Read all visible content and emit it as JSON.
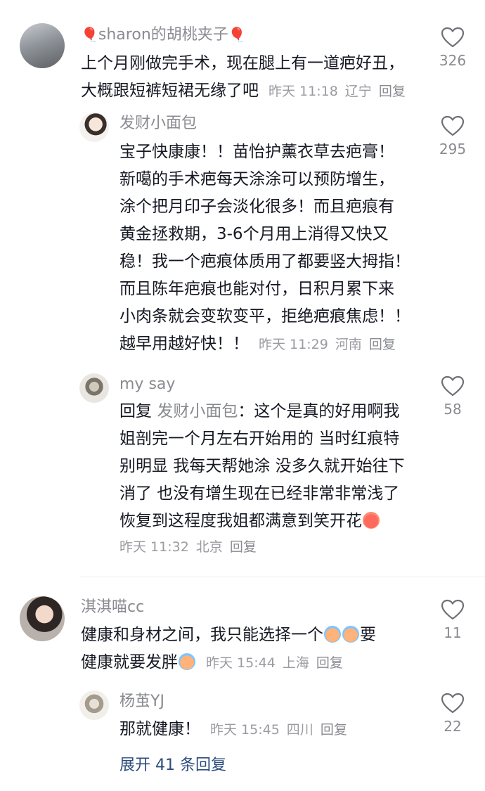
{
  "comments": [
    {
      "username": "sharon的胡桃夹子",
      "lines": [
        "上个月刚做完手术，现在腿上有一道疤好丑，",
        "大概跟短裤短裙无缘了吧"
      ],
      "time": "昨天 11:18",
      "location": "辽宁",
      "reply_label": "回复",
      "likes": "326",
      "avatar": "avatar-building"
    },
    {
      "username": "发财小面包",
      "lines": [
        "宝子快康康！！苗怡护薰衣草去疤膏！",
        "新噶的手术疤每天涂涂可以预防增生，",
        "涂个把月印子会淡化很多！而且疤痕有",
        "黄金拯救期，3-6个月用上消得又快又",
        "稳！我一个疤痕体质用了都要竖大拇指！",
        "而且陈年疤痕也能对付，日积月累下来",
        "小肉条就会变软变平，拒绝疤痕焦虑！！",
        "越早用越好快！！"
      ],
      "time": "昨天 11:29",
      "location": "河南",
      "reply_label": "回复",
      "likes": "295"
    },
    {
      "username": "my say",
      "reply_prefix": "回复",
      "reply_to": "发财小面包",
      "lines": [
        "：这个是真的好用啊我",
        "姐剖完一个月左右开始用的 当时红痕特",
        "别明显 我每天帮她涂 没多久就开始往下",
        "消了 也没有增生现在已经非常非常浅了",
        "恢复到这程度我姐都满意到笑开花"
      ],
      "time": "昨天 11:32",
      "location": "北京",
      "reply_label": "回复",
      "likes": "58",
      "emoji": "laughing-emoji"
    },
    {
      "username": "淇淇喵cc",
      "lines": [
        "健康和身材之间，我只能选择一个",
        "要",
        "健康就要发胖"
      ],
      "time": "昨天 15:44",
      "location": "上海",
      "reply_label": "回复",
      "likes": "11",
      "emoji": "crying-emoji"
    },
    {
      "username": "杨茧YJ",
      "lines": [
        "那就健康！"
      ],
      "time": "昨天 15:45",
      "location": "四川",
      "reply_label": "回复",
      "likes": "22"
    }
  ],
  "expand_replies": "展开 41 条回复",
  "colors": {
    "text": "#161823",
    "muted": "#8a8b91",
    "link": "#2c4c7c",
    "balloon": "#e8323c"
  },
  "icons": {
    "like": "heart-outline-icon",
    "balloon": "balloon-icon"
  }
}
